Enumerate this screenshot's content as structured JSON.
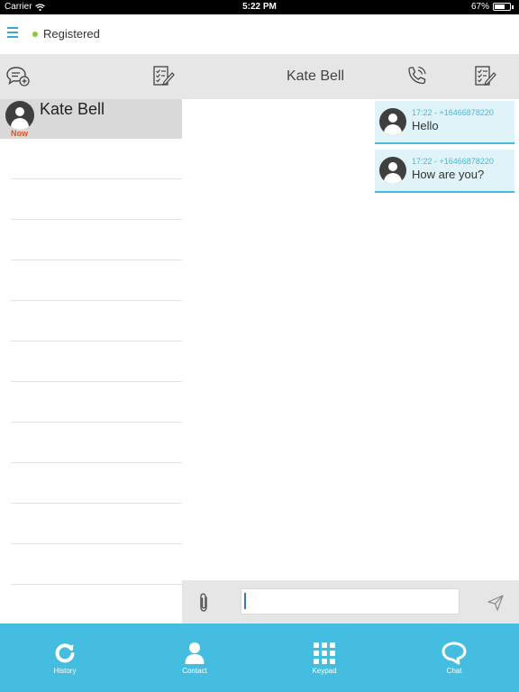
{
  "status_bar": {
    "carrier": "Carrier",
    "time": "5:22 PM",
    "battery_percent_label": "67%",
    "battery_level": 0.67
  },
  "registration": {
    "status_text": "Registered",
    "status_color": "#8dc63f"
  },
  "toolbar": {
    "new_chat_icon": "new-chat-bubble-icon",
    "left_edit_icon": "checklist-edit-icon",
    "chat_title": "Kate Bell",
    "call_icon": "phone-call-icon",
    "right_edit_icon": "checklist-edit-icon"
  },
  "conversations": [
    {
      "name": "Kate Bell",
      "time": "Now",
      "selected": true
    }
  ],
  "messages": [
    {
      "meta": "17:22 - +16466878220",
      "text": "Hello"
    },
    {
      "meta": "17:22 - +16466878220",
      "text": "How are you?"
    }
  ],
  "composer": {
    "value": "",
    "attach_icon": "paperclip-icon",
    "send_icon": "send-arrow-icon"
  },
  "tabs": [
    {
      "label": "History",
      "icon": "refresh-icon"
    },
    {
      "label": "Contact",
      "icon": "person-icon"
    },
    {
      "label": "Keypad",
      "icon": "keypad-grid-icon"
    },
    {
      "label": "Chat",
      "icon": "chat-bubble-icon"
    }
  ],
  "colors": {
    "accent": "#45bde0",
    "message_bubble": "#dff3f9",
    "message_meta": "#4ab9de",
    "time_badge": "#e8501e",
    "toolbar_bg": "#e6e6e6"
  }
}
